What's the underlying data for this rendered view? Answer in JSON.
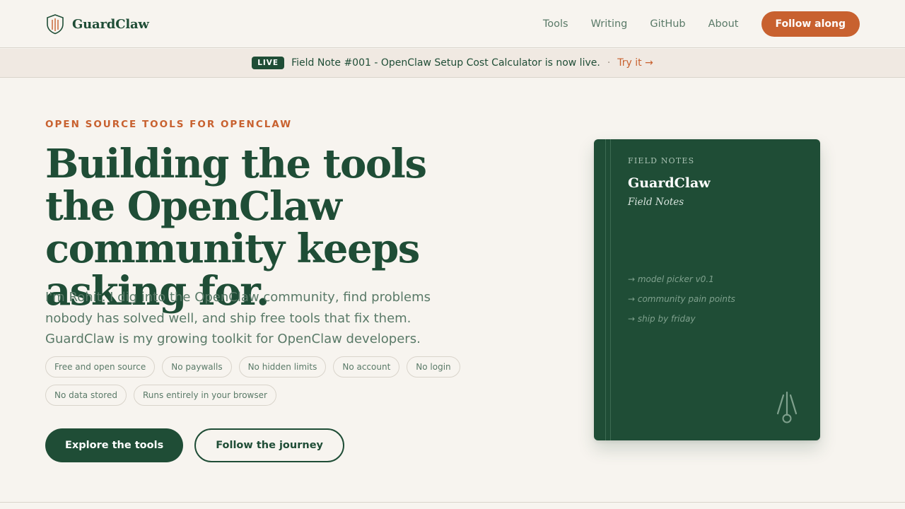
{
  "brand": {
    "name": "GuardClaw",
    "logo_icon": "shield-claw-icon"
  },
  "nav": {
    "links": [
      "Tools",
      "Writing",
      "GitHub",
      "About"
    ],
    "cta": "Follow along"
  },
  "banner": {
    "badge": "LIVE",
    "text": "Field Note #001 - OpenClaw Setup Cost Calculator is now live.",
    "separator": "·",
    "link": "Try it →"
  },
  "hero": {
    "eyebrow": "OPEN SOURCE TOOLS FOR OPENCLAW",
    "headline": "Building the tools the OpenClaw community keeps asking for.",
    "lede": "I'm Rohit. I dig into the OpenClaw community, find problems nobody has solved well, and ship free tools that fix them. GuardClaw is my growing toolkit for OpenClaw developers.",
    "chips": [
      "Free and open source",
      "No paywalls",
      "No hidden limits",
      "No account",
      "No login",
      "No data stored",
      "Runs entirely in your browser"
    ],
    "primary_cta": "Explore the tools",
    "secondary_cta": "Follow the journey"
  },
  "notebook": {
    "eyebrow": "FIELD NOTES",
    "title": "GuardClaw",
    "subtitle": "Field Notes",
    "notes": [
      "→ model picker v0.1",
      "→ community pain points",
      "→ ship by friday"
    ],
    "mark_icon": "claw-mark-icon"
  },
  "colors": {
    "background": "#f7f4ef",
    "primary_green": "#1f4d36",
    "accent_orange": "#c8612f",
    "muted_text": "#5a7a68",
    "border": "#d9d4cb",
    "banner_bg": "#f0e9e2"
  }
}
